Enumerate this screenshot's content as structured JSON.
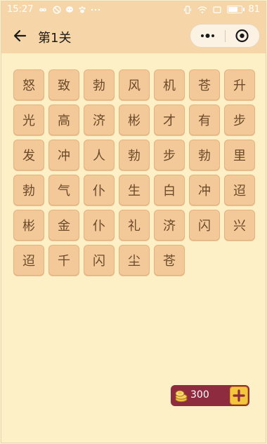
{
  "status": {
    "time": "15:27",
    "battery": "81",
    "battery_level": 0.81,
    "left_icons": [
      "infinity-icon",
      "clock-icon",
      "chat-bubble-icon",
      "paw-icon",
      "more-dots-icon"
    ],
    "right_icons": [
      "vibrate-icon",
      "wifi-icon",
      "screen-icon",
      "battery-icon"
    ]
  },
  "navbar": {
    "title": "第1关",
    "back_icon": "back-arrow-icon",
    "more_icon": "more-dots-icon",
    "close_icon": "target-close-icon"
  },
  "tiles": [
    "怒",
    "致",
    "勃",
    "风",
    "机",
    "苍",
    "升",
    "光",
    "高",
    "济",
    "彬",
    "才",
    "有",
    "步",
    "发",
    "冲",
    "人",
    "勃",
    "步",
    "勃",
    "里",
    "勃",
    "气",
    "仆",
    "生",
    "白",
    "冲",
    "迢",
    "彬",
    "金",
    "仆",
    "礼",
    "济",
    "闪",
    "兴",
    "迢",
    "千",
    "闪",
    "尘",
    "苍"
  ],
  "coins": {
    "count": "300",
    "icon": "coin-stack-icon",
    "add_icon": "plus-icon"
  },
  "colors": {
    "header_bg": "#f6d6a8",
    "page_bg": "#fdf0c6",
    "tile_bg": "#f4c99a",
    "tile_text": "#6a4a2a",
    "coin_bar_bg": "#8e2b3f",
    "plus_bg": "#f4c63c"
  }
}
